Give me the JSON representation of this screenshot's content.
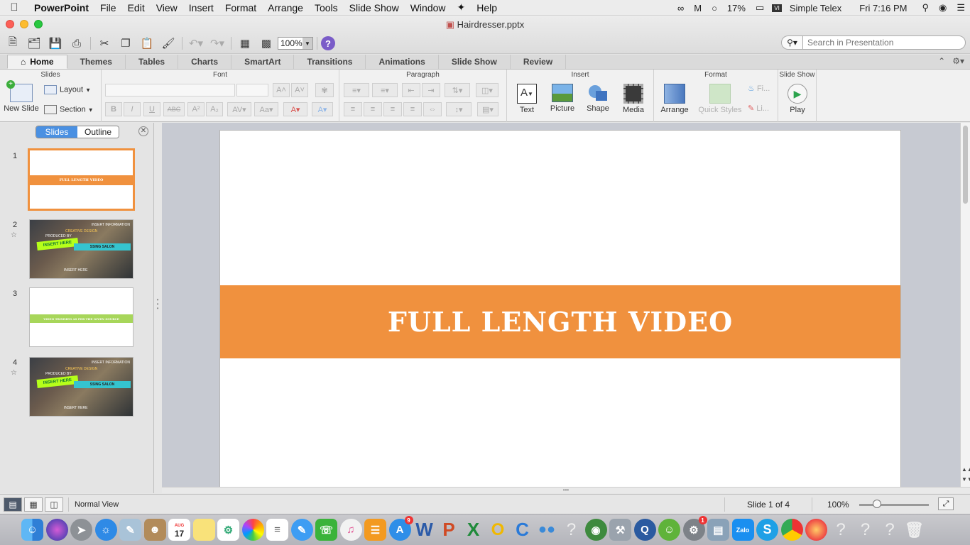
{
  "menubar": {
    "app_name": "PowerPoint",
    "items": [
      "File",
      "Edit",
      "View",
      "Insert",
      "Format",
      "Arrange",
      "Tools",
      "Slide Show",
      "Window",
      "Help"
    ],
    "battery": "17%",
    "input_source": "Simple Telex",
    "clock": "Fri 7:16 PM"
  },
  "window": {
    "title": "Hairdresser.pptx",
    "zoom_value": "100%",
    "search_placeholder": "Search in Presentation"
  },
  "ribbon_tabs": [
    "Home",
    "Themes",
    "Tables",
    "Charts",
    "SmartArt",
    "Transitions",
    "Animations",
    "Slide Show",
    "Review"
  ],
  "ribbon": {
    "groups": {
      "slides": "Slides",
      "font": "Font",
      "paragraph": "Paragraph",
      "insert": "Insert",
      "format": "Format",
      "slideshow": "Slide Show"
    },
    "buttons": {
      "new_slide": "New Slide",
      "layout": "Layout",
      "section": "Section",
      "text": "Text",
      "picture": "Picture",
      "shape": "Shape",
      "media": "Media",
      "arrange": "Arrange",
      "quick_styles": "Quick Styles",
      "fill": "Fi...",
      "line": "Li...",
      "play": "Play"
    }
  },
  "left_pane": {
    "seg_slides": "Slides",
    "seg_outline": "Outline",
    "thumbnails": [
      {
        "num": "1",
        "text": "FULL LENGTH VIDEO"
      },
      {
        "num": "2",
        "info": "INSERT INFORMATION",
        "design": "CREATIVE DESIGN",
        "producer": "PRODUCED BY",
        "lime": "INSERT HERE",
        "cyan": "SSING SALON",
        "bottom": "INSERT HERE"
      },
      {
        "num": "3",
        "text": "VIDEO TRIMMED AS PER THE GIVEN SOURCE"
      },
      {
        "num": "4",
        "info": "INSERT INFORMATION",
        "design": "CREATIVE DESIGN",
        "producer": "PRODUCED BY",
        "lime": "INSERT HERE",
        "cyan": "SSING SALON",
        "bottom": "INSERT HERE"
      }
    ]
  },
  "slide": {
    "title": "FULL LENGTH VIDEO",
    "band_color": "#f0913e"
  },
  "status": {
    "view_name": "Normal View",
    "slide_indicator": "Slide 1 of 4",
    "zoom": "100%"
  },
  "dock": {
    "calendar_month": "AUG",
    "calendar_day": "17",
    "appstore_badge": "9",
    "prefs_badge": "1",
    "zalo_label": "Zalo"
  }
}
